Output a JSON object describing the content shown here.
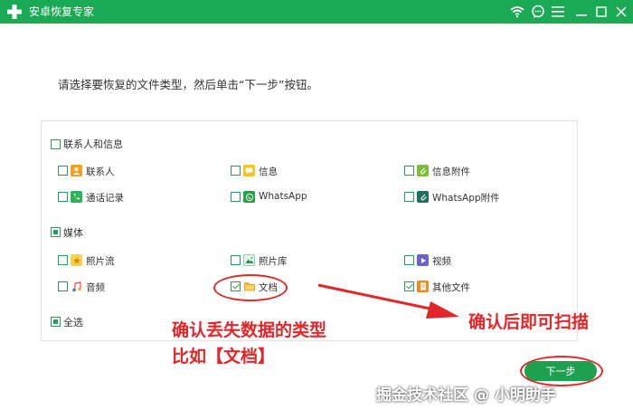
{
  "titlebar": {
    "title": "安卓恢复专家",
    "bg_color": "#1aaa55",
    "icons": [
      "wifi-icon",
      "chat-icon",
      "menu-icon",
      "minimize-icon",
      "maximize-icon",
      "close-icon"
    ]
  },
  "instruction": "请选择要恢复的文件类型，然后单击“下一步”按钮。",
  "groups": {
    "contacts": {
      "label": "联系人和信息",
      "items": [
        "联系人",
        "信息",
        "信息附件",
        "通话记录",
        "WhatsApp",
        "WhatsApp附件"
      ]
    },
    "media": {
      "label": "媒体",
      "items": [
        "照片流",
        "照片库",
        "视频",
        "音频",
        "文档",
        "其他文件"
      ]
    },
    "select_all": "全选"
  },
  "annotations": {
    "left_line1": "确认丢失数据的类型",
    "left_line2": "比如【文档】",
    "right": "确认后即可扫描",
    "color": "#e3262a"
  },
  "next_button": "下一步",
  "watermark": "掘金技术社区 @ 小明助手"
}
